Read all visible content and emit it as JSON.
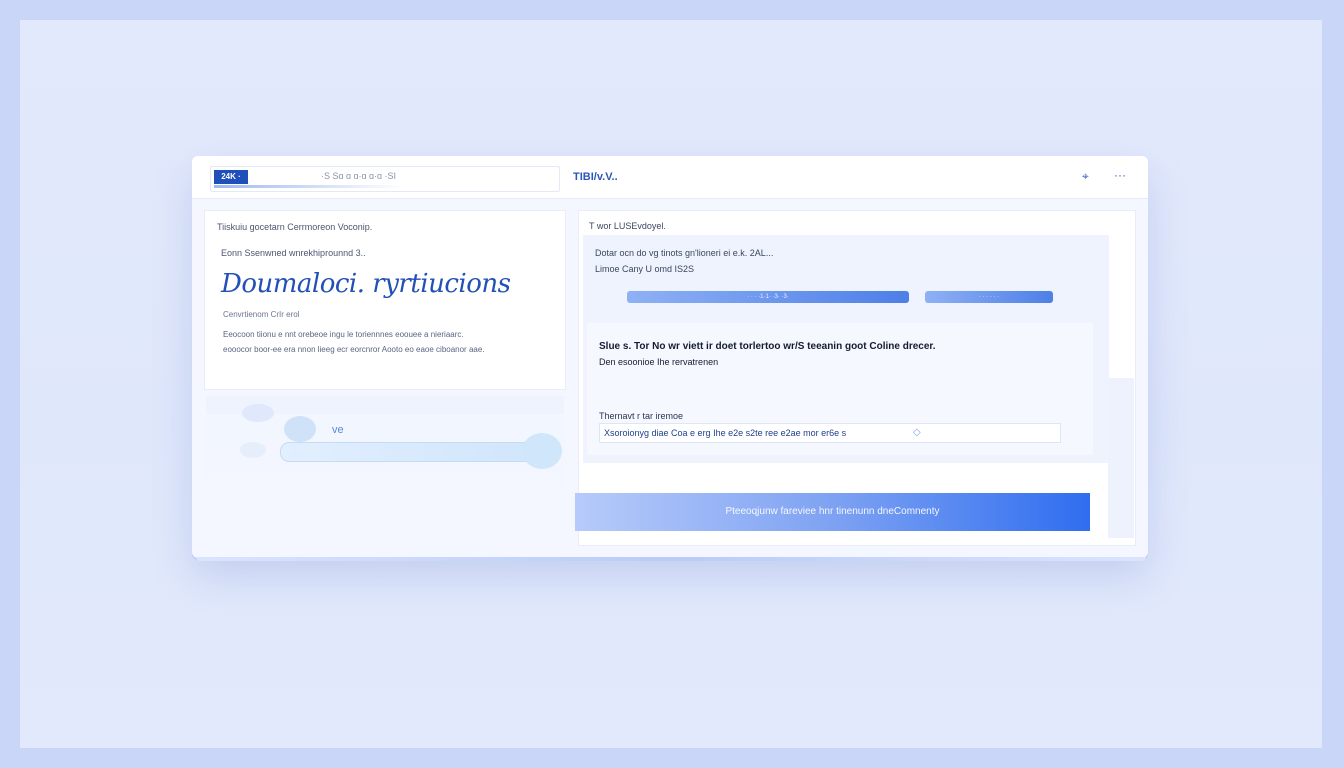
{
  "header": {
    "logo_text": "24K ·",
    "brand_text": "·S Sɑ ɑ ɑ·ɑ ɑ·ɑ ·SI",
    "title": "TIBI/v.V..",
    "icons": [
      "pin-icon",
      "more-icon"
    ],
    "pin_glyph": "⌖",
    "more_glyph": "···"
  },
  "left": {
    "top_note": "Tiiskuiu gocetarn Cerrmoreon Voconip.",
    "sub_note": "Eonn Ssenwned wnrekhiprounnd 3..",
    "headline": "Doumaloci. ryrtiucions",
    "meta": "Cenvrtienom CrIr erol",
    "desc_lines": [
      "Eeocoon tiionu e nnt orebeoe ingu le toriennnes eoouee a nieriaarc.",
      "eooocor boor-ee era nnon lieeg ecr eorcnror Aooto eo eaoe ciboanor aae."
    ],
    "progress_label": "ve"
  },
  "right": {
    "section_title": "T wor LUSEvdoyel.",
    "line_1": "Dotar ocn do vg tinots gn'lioneri ei e.k. 2AL...",
    "line_2": "Limoe Cany U omd IS2S",
    "bar_btn_1": "· · ·  ·1·1·   ·3·   ·3·",
    "bar_btn_2": "· · · · · ·",
    "notice_line": "Slue s. Tor No wr viett ir doet torlertoo wr/S teeanin goot Coline drecer.",
    "notice_sub": "Den esoonioe Ihe rervatrenen",
    "field_label": "Thernavt r tar iremoe",
    "field_value": "Xsoroionyg diae Coa e erg Ihe e2e s2te ree e2ae mor er6e s",
    "cta_label": "Pteeoqjunw fareviee hnr tinenunn dneComnenty",
    "diamond_glyph": "◇"
  }
}
